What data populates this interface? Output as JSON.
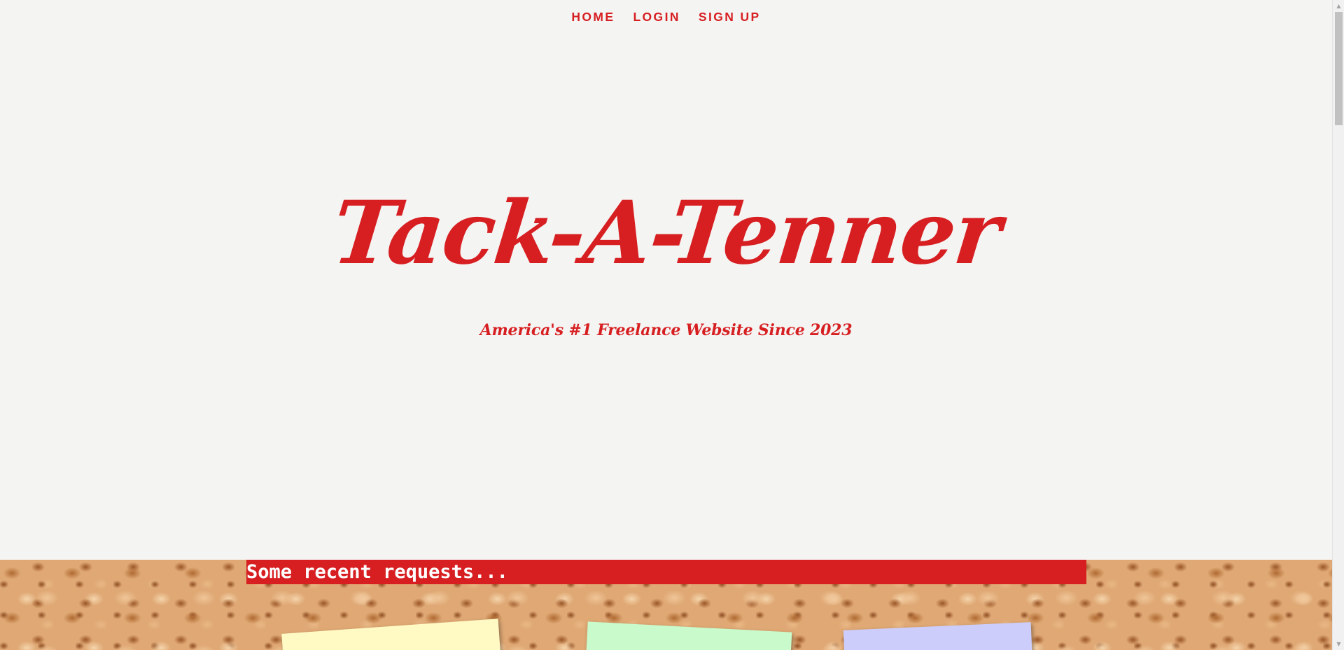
{
  "nav": {
    "items": [
      {
        "label": "HOME"
      },
      {
        "label": "LOGIN"
      },
      {
        "label": "SIGN UP"
      }
    ]
  },
  "hero": {
    "title": "Tack-A-Tenner",
    "subtitle": "America's #1 Freelance Website Since 2023"
  },
  "recent": {
    "heading": "Some recent requests..."
  },
  "colors": {
    "accent": "#d71f22",
    "background": "#f4f4f2",
    "note_yellow": "#fff9c4",
    "note_green": "#c8facb",
    "note_blue": "#cdcdfb"
  },
  "scrollbar": {
    "up_icon": "chevron-up-icon",
    "down_icon": "chevron-down-icon"
  }
}
